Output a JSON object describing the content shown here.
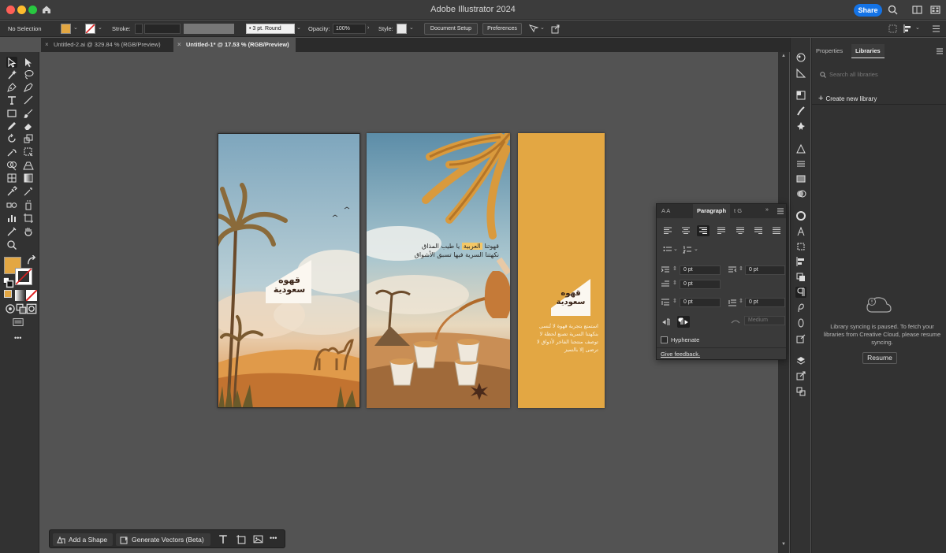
{
  "window": {
    "title": "Adobe Illustrator 2024",
    "share_label": "Share"
  },
  "controlbar": {
    "selection": "No Selection",
    "stroke_label": "Stroke:",
    "brush_value": "3 pt. Round",
    "opacity_label": "Opacity:",
    "opacity_value": "100%",
    "style_label": "Style:",
    "doc_setup_label": "Document Setup",
    "preferences_label": "Preferences",
    "fill_color": "#e3a743"
  },
  "tabs": [
    {
      "label": "Untitled-2.ai @ 329.84 % (RGB/Preview)",
      "close": "×"
    },
    {
      "label": "Untitled-1* @ 17.53 % (RGB/Preview)",
      "close": "×"
    }
  ],
  "artboards": {
    "logo_line1": "قهوه",
    "logo_line2": "سعودية",
    "ab2_heading_line1_a": "قهوتنا",
    "ab2_heading_line1_highlight": "العربية",
    "ab2_heading_line1_b": "يا طيب المذاق",
    "ab2_heading_line2": "نكهتنا السرية فيها تسبق الأشواق",
    "ab3_body": "استمتع بتجربة قهوة لا تُنسى بنكهتنا السرية تصنع لحظة لا توصف منتجنا الفاخر لأذواق لا ترضى إلا بالتميز"
  },
  "floatbar": {
    "add_shape_label": "Add a Shape",
    "generate_vectors_label": "Generate Vectors (Beta)",
    "more": "•••"
  },
  "paragraph_panel": {
    "tab_label": "Paragraph",
    "tab_left_1": "A",
    "tab_left_2": "A",
    "tab_right_1": "t",
    "tab_right_2": "G",
    "left_indent": "0 pt",
    "right_indent": "0 pt",
    "first_line_indent": "0 pt",
    "space_before": "0 pt",
    "space_after": "0 pt",
    "kashida_value": "Medium",
    "hyphenate_label": "Hyphenate",
    "feedback_label": "Give feedback."
  },
  "right_panel": {
    "tab_properties": "Properties",
    "tab_libraries": "Libraries",
    "search_placeholder": "Search all libraries",
    "create_new": "Create new library",
    "sync_message": "Library syncing is paused. To fetch your libraries from Creative Cloud, please resume syncing.",
    "resume_label": "Resume"
  },
  "lefttools": {
    "more": "•••"
  },
  "colors": {
    "accent_blue": "#1473e6",
    "artboard_orange": "#e3a743",
    "panel_bg": "#323232",
    "canvas_bg": "#535353"
  }
}
